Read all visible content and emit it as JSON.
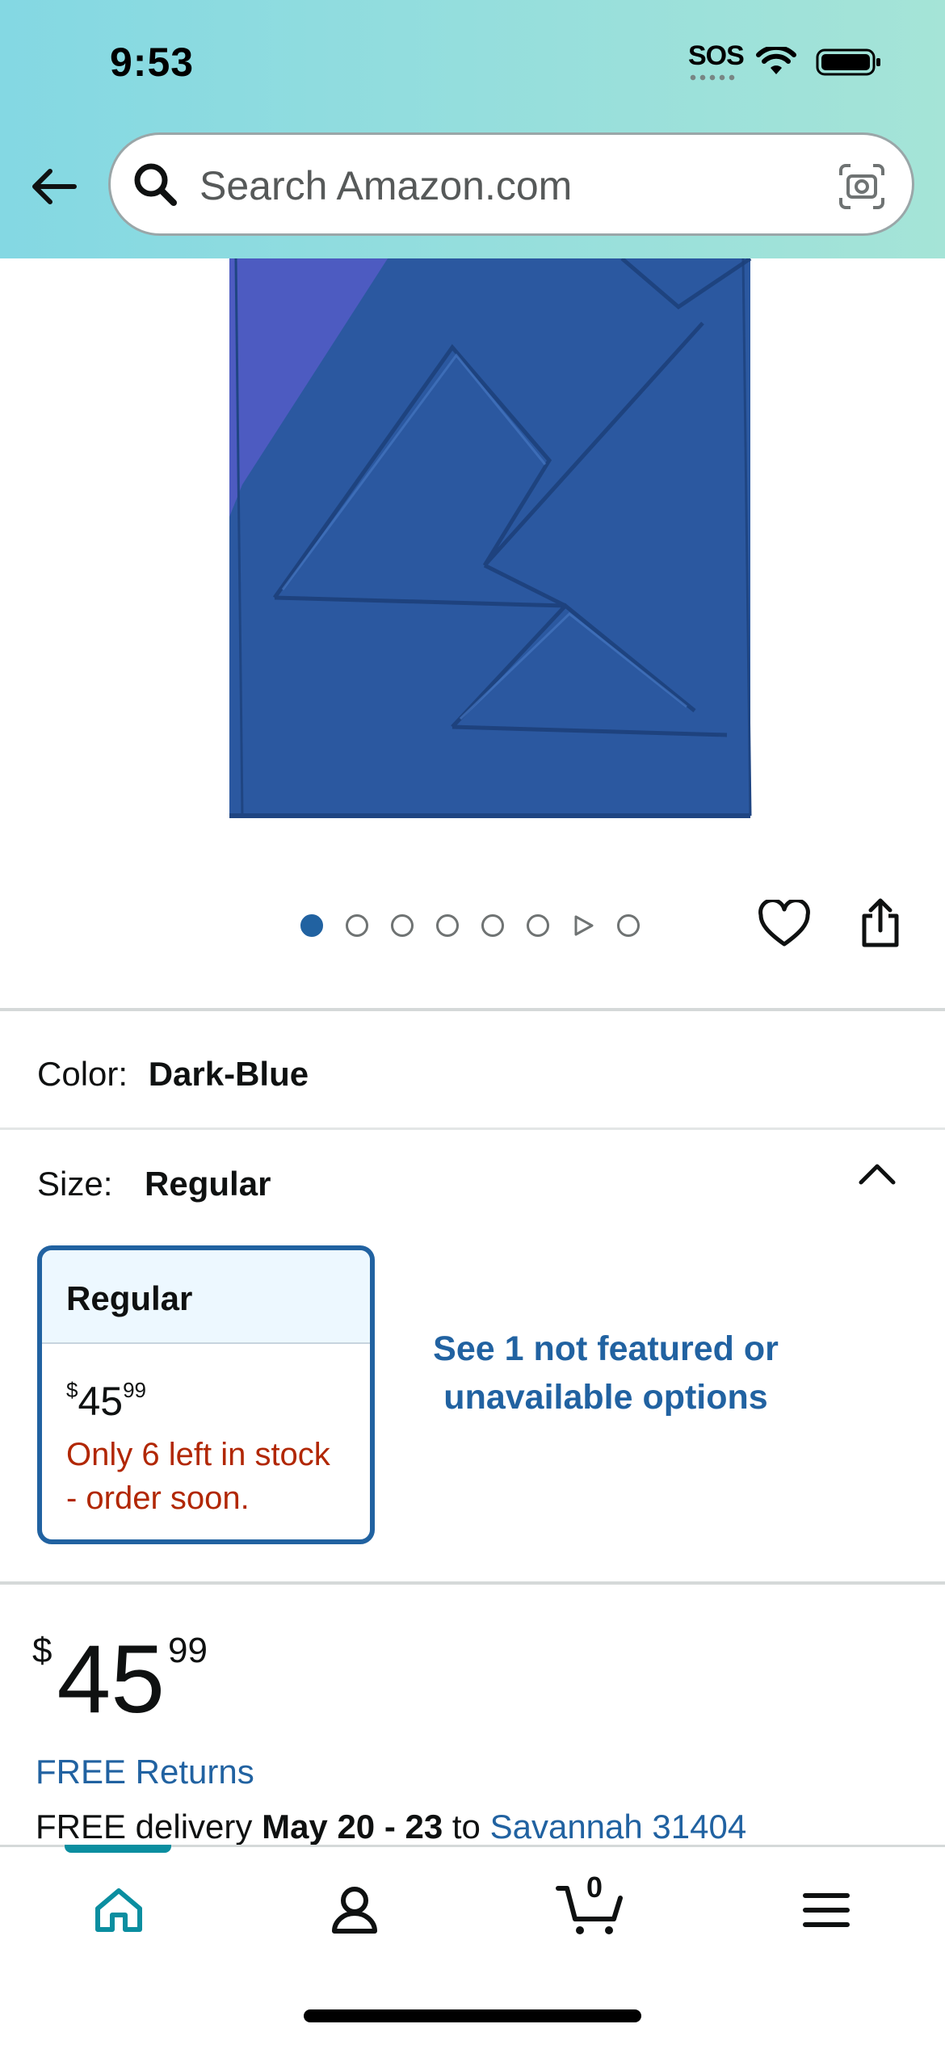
{
  "status_bar": {
    "time": "9:53",
    "sos": "SOS"
  },
  "search": {
    "placeholder": "Search Amazon.com"
  },
  "carousel": {
    "total_images": 8,
    "active_index": 0,
    "video_index": 6
  },
  "product": {
    "color_label": "Color:",
    "color_value": "Dark-Blue",
    "size_label": "Size:",
    "size_value": "Regular",
    "size_card": {
      "name": "Regular",
      "currency": "$",
      "price_whole": "45",
      "price_cents": "99",
      "stock_line1": "Only 6 left in stock",
      "stock_line2": "- order soon."
    },
    "see_options": "See 1 not featured or unavailable options",
    "price": {
      "currency": "$",
      "whole": "45",
      "cents": "99"
    },
    "free_returns": "FREE Returns",
    "delivery": {
      "prefix": "FREE delivery",
      "dates": "May 20 - 23",
      "to": "to",
      "location": "Savannah 31404"
    }
  },
  "bottom_nav": {
    "cart_count": "0",
    "active": "home"
  },
  "colors": {
    "header_start": "#84d8e3",
    "header_end": "#a5e4d7",
    "link": "#2162a1",
    "stock_warning": "#b12704",
    "nav_active": "#0b8ea0",
    "product_blue": "#2b58a0"
  }
}
